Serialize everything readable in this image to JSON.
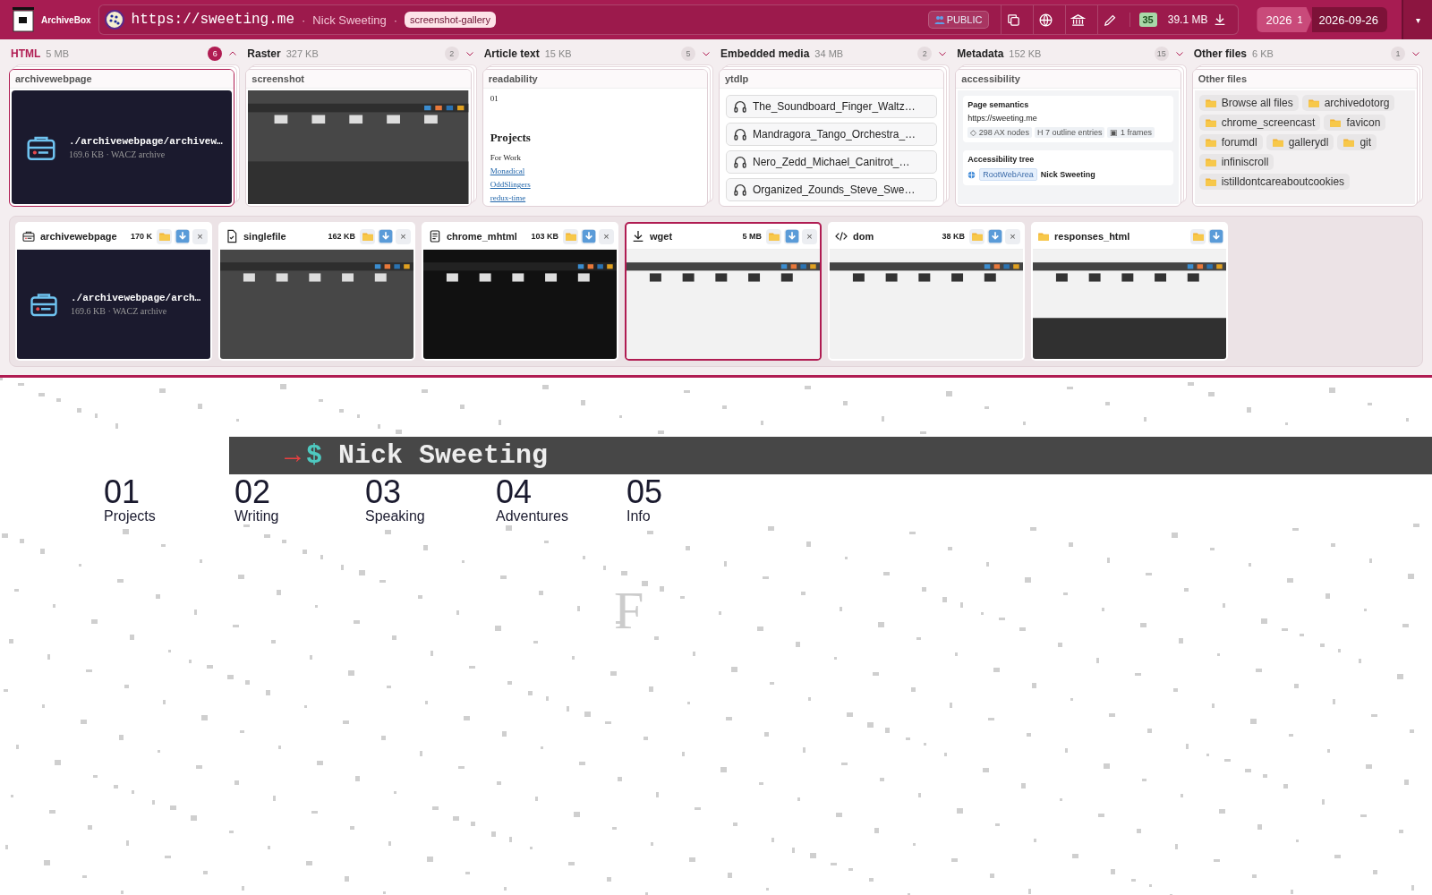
{
  "header": {
    "logo": "ArchiveBox",
    "url": "https://sweeting.me",
    "separators": [
      "·",
      "·"
    ],
    "title": "Nick Sweeting",
    "tag": "screenshot-gallery",
    "visibility": "PUBLIC",
    "file_count": "35",
    "size": "39.1 MB",
    "snapshot_year": "2026",
    "snapshot_count": "1",
    "current_date": "2026-09-26",
    "menu": "▾"
  },
  "sections": [
    {
      "title": "HTML",
      "size": "5 MB",
      "count": "6",
      "expanded": true,
      "card": {
        "kind": "archive",
        "title": "archivewebpage",
        "path": "./archivewebpage/archivew…",
        "meta": "169.6 KB · WACZ archive"
      }
    },
    {
      "title": "Raster",
      "size": "327 KB",
      "count": "2",
      "expanded": false,
      "card": {
        "kind": "picture",
        "title": "screenshot"
      }
    },
    {
      "title": "Article text",
      "size": "15 KB",
      "count": "5",
      "expanded": false,
      "card": {
        "kind": "readability",
        "title": "readability",
        "number": "01",
        "heading": "Projects",
        "subheading": "For Work",
        "links": [
          "Monadical",
          "OddSlingers",
          "redux-time"
        ]
      }
    },
    {
      "title": "Embedded media",
      "size": "34 MB",
      "count": "2",
      "expanded": false,
      "card": {
        "kind": "media",
        "title": "ytdlp",
        "items": [
          "The_Soundboard_Finger_Waltz…",
          "Mandragora_Tango_Orchestra_…",
          "Nero_Zedd_Michael_Canitrot_…",
          "Organized_Zounds_Steve_Swe…"
        ]
      }
    },
    {
      "title": "Metadata",
      "size": "152 KB",
      "count": "15",
      "expanded": false,
      "card": {
        "kind": "accessibility",
        "title": "accessibility",
        "semantics_heading": "Page semantics",
        "url": "https://sweeting.me",
        "chips": [
          "◇ 298 AX nodes",
          "H 7 outline entries",
          "▣ 1 frames"
        ],
        "tree_heading": "Accessibility tree",
        "role": "RootWebArea",
        "node": "Nick Sweeting"
      }
    },
    {
      "title": "Other files",
      "size": "6 KB",
      "count": "1",
      "expanded": false,
      "card": {
        "kind": "files",
        "title": "Other files",
        "files": [
          "Browse all files",
          "archivedotorg",
          "chrome_screencast",
          "favicon",
          "forumdl",
          "gallerydl",
          "git",
          "infiniscroll",
          "istilldontcareaboutcookies"
        ]
      }
    }
  ],
  "outputs": [
    {
      "kind": "archive",
      "name": "archivewebpage",
      "size": "170 K",
      "selected": false,
      "close": "×",
      "preview": {
        "kind": "archive",
        "path": "./archivewebpage/arch…",
        "meta": "169.6 KB · WACZ archive"
      }
    },
    {
      "kind": "singlefile",
      "name": "singlefile",
      "size": "162 KB",
      "selected": false,
      "close": "×"
    },
    {
      "kind": "document",
      "name": "chrome_mhtml",
      "size": "103 KB",
      "selected": false,
      "close": "×"
    },
    {
      "kind": "download",
      "name": "wget",
      "size": "5 MB",
      "selected": true,
      "close": "×"
    },
    {
      "kind": "code",
      "name": "dom",
      "size": "38 KB",
      "selected": false,
      "close": "×"
    },
    {
      "kind": "folder",
      "name": "responses_html",
      "selected": false
    }
  ],
  "site": {
    "arrow": "→",
    "prompt": "$",
    "name": "Nick Sweeting",
    "nav": [
      {
        "number": "01",
        "label": "Projects"
      },
      {
        "number": "02",
        "label": "Writing"
      },
      {
        "number": "03",
        "label": "Speaking"
      },
      {
        "number": "04",
        "label": "Adventures"
      },
      {
        "number": "05",
        "label": "Info"
      }
    ],
    "letter": "F"
  }
}
